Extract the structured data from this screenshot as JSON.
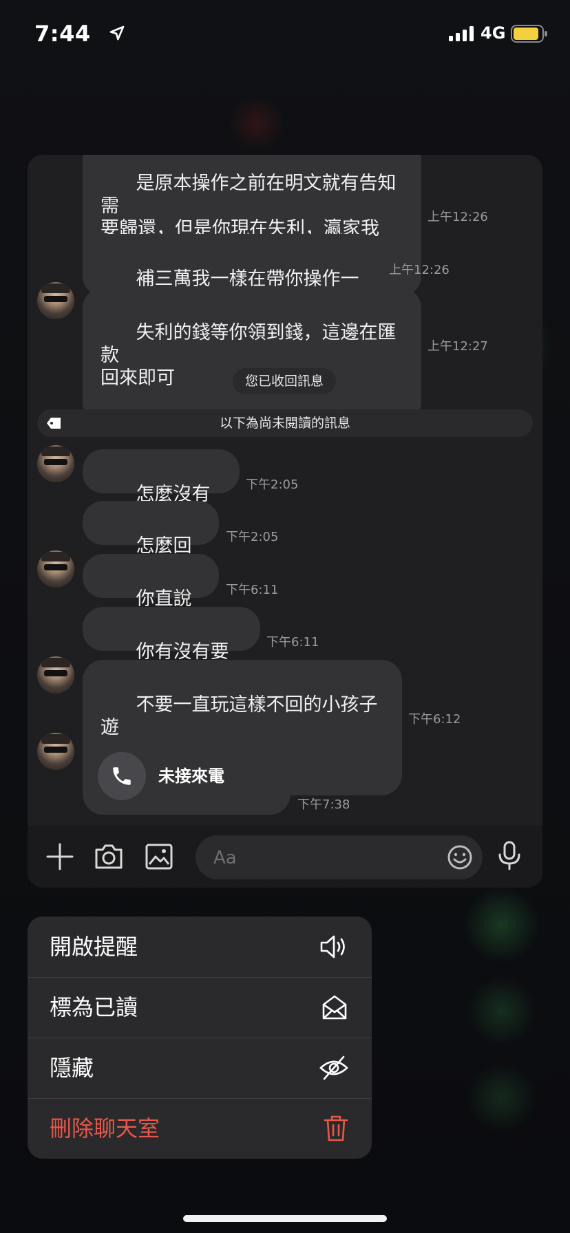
{
  "status_bar": {
    "time": "7:44",
    "network": "4G"
  },
  "messages": [
    {
      "text": "是原本操作之前在明文就有告知需\n要歸還，但是你現在失利，瀛家我\n也不想讓你這樣虧錢",
      "time": "上午12:26"
    },
    {
      "text": "補三萬我一樣在帶你操作一次",
      "time": "上午12:26"
    },
    {
      "text": "失利的錢等你領到錢，這邊在匯款\n回來即可",
      "time": "上午12:27"
    },
    {
      "text": "怎麼沒有回覆",
      "time": "下午2:05"
    },
    {
      "text": "怎麼回事？",
      "time": "下午2:05"
    },
    {
      "text": "你直說吧！",
      "time": "下午6:11"
    },
    {
      "text": "你有沒有要處理",
      "time": "下午6:11"
    },
    {
      "text": "不要一直玩這樣不回的小孩子遊\n戲！",
      "time": "下午6:12"
    }
  ],
  "recalled_notice": "您已收回訊息",
  "unread_divider": "以下為尚未閱讀的訊息",
  "missed_call": {
    "label": "未接來電",
    "time": "下午7:38"
  },
  "input": {
    "placeholder": "Aa"
  },
  "menu": [
    {
      "label": "開啟提醒",
      "icon": "speaker-icon"
    },
    {
      "label": "標為已讀",
      "icon": "open-envelope-icon"
    },
    {
      "label": "隱藏",
      "icon": "eye-slash-icon"
    },
    {
      "label": "刪除聊天室",
      "icon": "trash-icon",
      "color": "#e8574a"
    }
  ]
}
